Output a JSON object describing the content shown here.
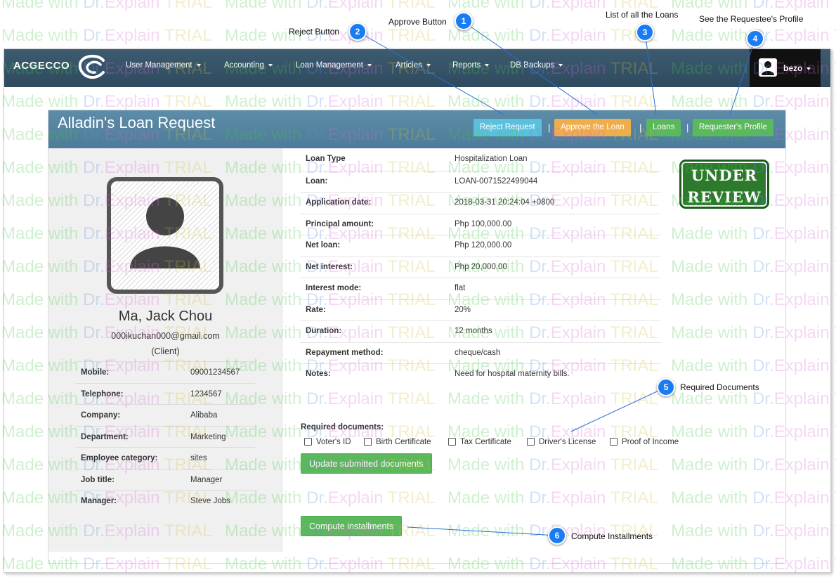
{
  "navbar": {
    "brand": "ACGECCO",
    "items": [
      {
        "label": "User Management"
      },
      {
        "label": "Accounting"
      },
      {
        "label": "Loan Management"
      },
      {
        "label": "Articles"
      },
      {
        "label": "Reports"
      },
      {
        "label": "DB Backups"
      }
    ],
    "user": "bezo",
    "dropdown_icon": "caret-down-icon",
    "user_icon": "user-icon"
  },
  "panel": {
    "title": "Alladin's Loan Request",
    "actions": {
      "reject": "Reject Request",
      "approve": "Approve the Loan",
      "loans": "Loans",
      "profile": "Requester's Profile",
      "separator": "|"
    }
  },
  "profile": {
    "name": "Ma, Jack Chou",
    "email": "000ikuchan000@gmail.com",
    "role": "(Client)",
    "fields": [
      {
        "key": "Mobile:",
        "value": "09001234567"
      },
      {
        "key": "Telephone:",
        "value": "1234567"
      },
      {
        "key": "Company:",
        "value": "Alibaba"
      },
      {
        "key": "Department:",
        "value": "Marketing"
      },
      {
        "key": "Employee category:",
        "value": "sites"
      },
      {
        "key": "Job title:",
        "value": "Manager"
      },
      {
        "key": "Manager:",
        "value": "Steve Jobs"
      }
    ]
  },
  "loan": {
    "rows": [
      {
        "key": "Loan Type",
        "value": "Hospitalization Loan"
      },
      {
        "key": "Loan:",
        "value": "LOAN-0071522499044"
      },
      {
        "key": "Application date:",
        "value": "2018-03-31 20:24:04 +0800"
      },
      {
        "key": "Principal amount:",
        "value": "Php 100,000.00"
      },
      {
        "key": "Net loan:",
        "value": "Php 120,000.00"
      },
      {
        "key": "Net interest:",
        "value": "Php 20,000.00"
      },
      {
        "key": "Interest mode:",
        "value": "flat"
      },
      {
        "key": "Rate:",
        "value": "20%"
      },
      {
        "key": "Duration:",
        "value": "12 months"
      },
      {
        "key": "Repayment method:",
        "value": "cheque/cash"
      },
      {
        "key": "Notes:",
        "value": "Need for hospital maternity bills."
      }
    ],
    "status_stamp": [
      "UNDER",
      "REVIEW"
    ],
    "status_color": "#2d7a2d"
  },
  "documents": {
    "label": "Required documents:",
    "items": [
      {
        "label": "Voter's ID",
        "checked": false
      },
      {
        "label": "Birth Certificate",
        "checked": false
      },
      {
        "label": "Tax Certificate",
        "checked": false
      },
      {
        "label": "Driver's License",
        "checked": false
      },
      {
        "label": "Proof of Income",
        "checked": false
      }
    ],
    "update_button": "Update submitted documents",
    "compute_button": "Compute installments"
  },
  "callouts": [
    {
      "num": "1",
      "label": "Approve Button"
    },
    {
      "num": "2",
      "label": "Reject Button"
    },
    {
      "num": "3",
      "label": "List of all the Loans"
    },
    {
      "num": "4",
      "label": "See the Requestee's Profile"
    },
    {
      "num": "5",
      "label": "Required Documents"
    },
    {
      "num": "6",
      "label": "Compute Installments"
    }
  ],
  "watermark": {
    "parts": [
      "Made",
      "with",
      "Dr.",
      "Explain",
      "TRIAL"
    ]
  },
  "colors": {
    "navbar": "#2e4a5e",
    "panel_header": "#4c7c99",
    "info": "#5bc0de",
    "warning": "#f0ad4e",
    "success": "#5cb85c",
    "callout": "#1a7cf0"
  }
}
